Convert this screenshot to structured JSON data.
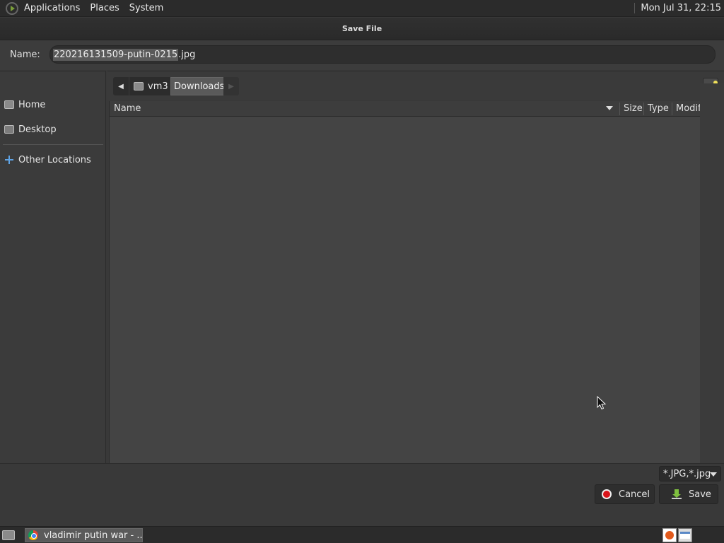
{
  "top_panel": {
    "menus": [
      "Applications",
      "Places",
      "System"
    ],
    "clock": "Mon Jul 31, 22:15"
  },
  "dialog": {
    "title": "Save File",
    "name_label": "Name:",
    "filename_selected": "220216131509-putin-0215",
    "filename_ext": ".jpg"
  },
  "sidebar": {
    "items": [
      {
        "label": "Home",
        "icon": "home-folder-icon"
      },
      {
        "label": "Desktop",
        "icon": "desktop-folder-icon"
      },
      {
        "label": "Other Locations",
        "icon": "plus-icon"
      }
    ]
  },
  "pathbar": {
    "segments": [
      "vm3",
      "Downloads"
    ],
    "active": "Downloads"
  },
  "file_list": {
    "columns": [
      "Name",
      "Size",
      "Type",
      "Modif"
    ],
    "rows": []
  },
  "filter": {
    "selected": "*.JPG,*.jpg"
  },
  "buttons": {
    "cancel": "Cancel",
    "save": "Save"
  },
  "taskbar": {
    "task_label": "vladimir putin war - ..."
  },
  "colors": {
    "cancel_icon": "#d9141a",
    "save_icon": "#7fbf3f",
    "other_locations_icon": "#5fa4e6"
  }
}
